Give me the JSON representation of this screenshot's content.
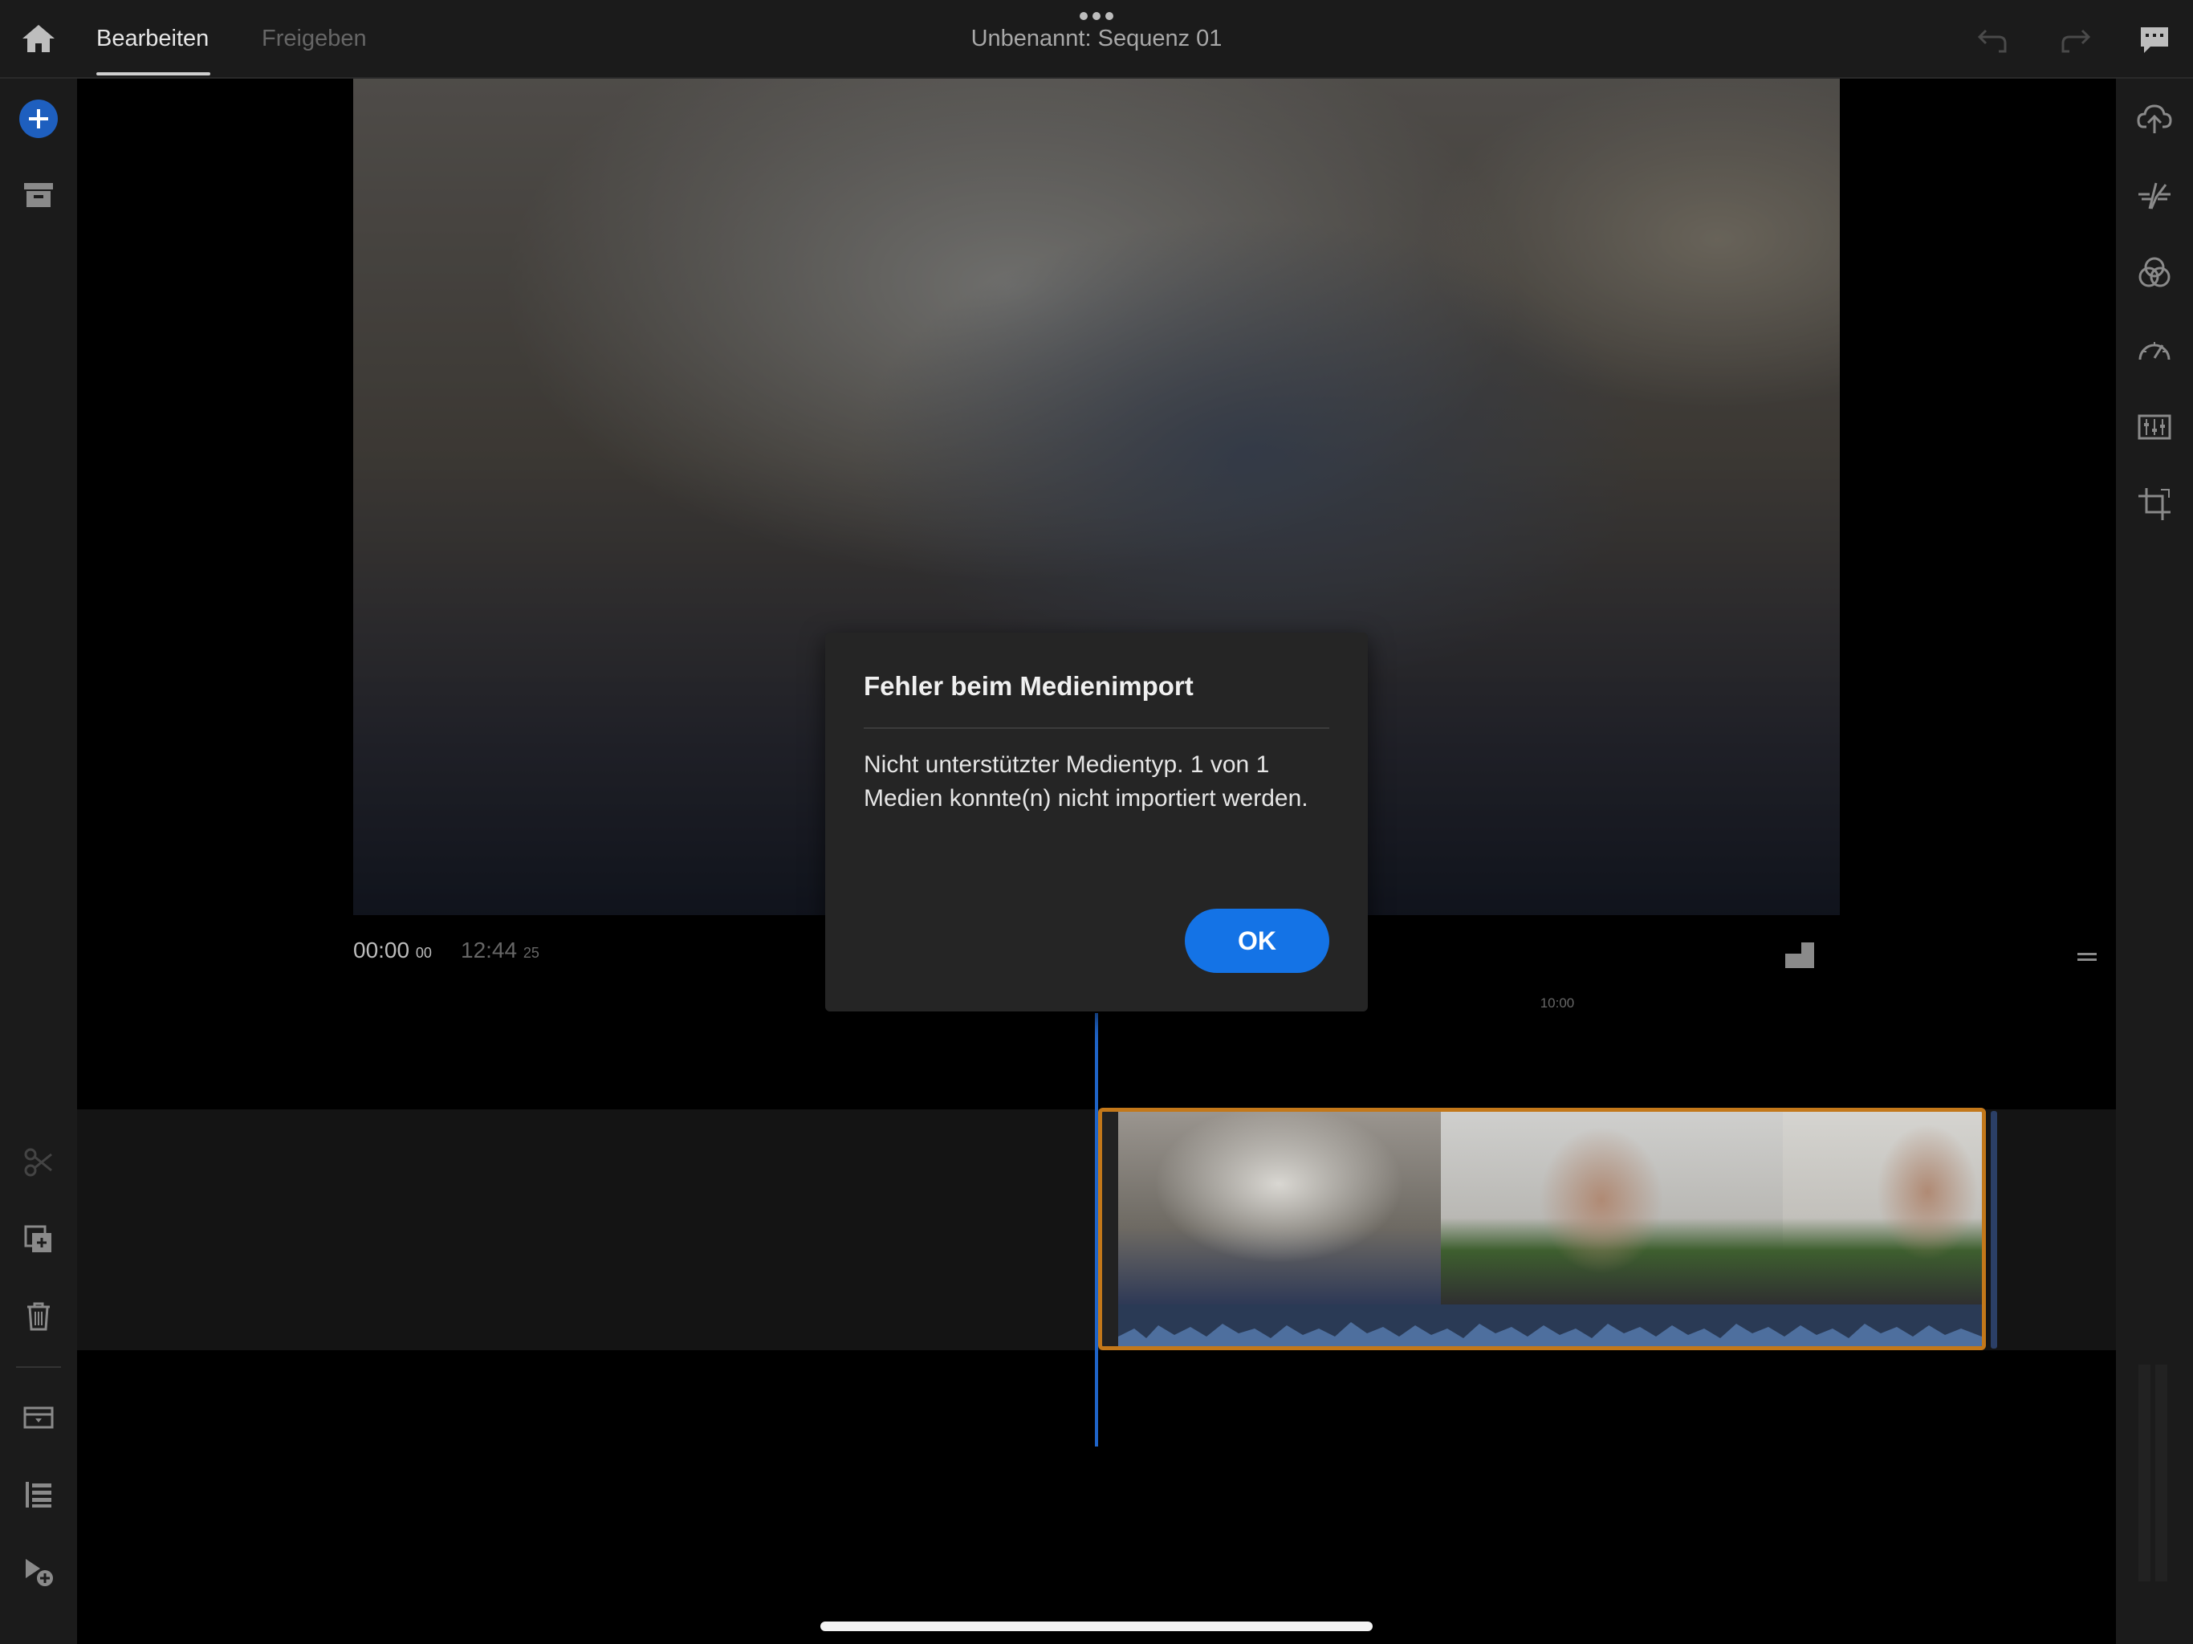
{
  "header": {
    "tabs": [
      {
        "label": "Bearbeiten",
        "active": true
      },
      {
        "label": "Freigeben",
        "active": false
      }
    ],
    "title": "Unbenannt: Sequenz 01"
  },
  "player": {
    "current_time": "00:00",
    "current_frames": "00",
    "duration": "12:44",
    "duration_frames": "25"
  },
  "timeline": {
    "ruler_label": "10:00"
  },
  "dialog": {
    "title": "Fehler beim Medienimport",
    "message": "Nicht unterstützter Medientyp. 1 von 1 Medien konnte(n) nicht importiert werden.",
    "ok_label": "OK"
  },
  "colors": {
    "accent": "#1473e6",
    "clip_selection": "#c3781a",
    "playhead": "#1f64c8",
    "rail_background": "#1b1b1b"
  },
  "icons": {
    "left_rail": [
      "add-media-icon",
      "project-icon",
      "split-icon",
      "duplicate-icon",
      "delete-icon",
      "tracks-icon",
      "list-icon",
      "add-clip-icon"
    ],
    "right_rail": [
      "upload-icon",
      "transitions-icon",
      "color-icon",
      "speed-icon",
      "audio-icon",
      "crop-icon"
    ]
  }
}
